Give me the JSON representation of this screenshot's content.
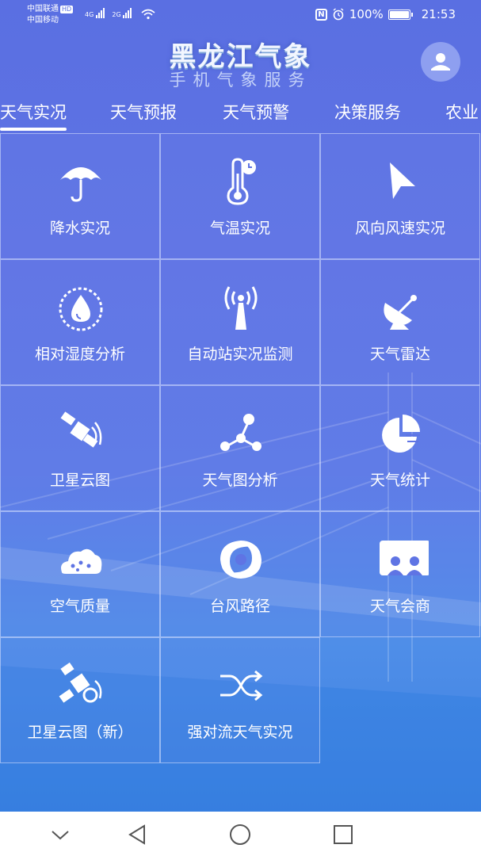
{
  "status_bar": {
    "carrier1": "中国联通",
    "hd_badge": "HD",
    "carrier2": "中国移动",
    "net1": "4G",
    "net2": "2G",
    "battery_percent": "100%",
    "battery_level": 1.0,
    "time": "21:53"
  },
  "header": {
    "title": "黑龙江气象",
    "subtitle": "手机气象服务"
  },
  "tabs": [
    "天气实况",
    "天气预报",
    "天气预警",
    "决策服务",
    "农业"
  ],
  "active_tab": "天气实况",
  "grid": {
    "items": [
      {
        "label": "降水实况",
        "icon": "umbrella-icon"
      },
      {
        "label": "气温实况",
        "icon": "thermometer-icon"
      },
      {
        "label": "风向风速实况",
        "icon": "wind-direction-icon"
      },
      {
        "label": "相对湿度分析",
        "icon": "humidity-gauge-icon"
      },
      {
        "label": "自动站实况监测",
        "icon": "weather-station-icon"
      },
      {
        "label": "天气雷达",
        "icon": "radar-dish-icon"
      },
      {
        "label": "卫星云图",
        "icon": "satellite-icon"
      },
      {
        "label": "天气图分析",
        "icon": "network-nodes-icon"
      },
      {
        "label": "天气统计",
        "icon": "pie-chart-icon"
      },
      {
        "label": "空气质量",
        "icon": "cloud-dots-icon"
      },
      {
        "label": "台风路径",
        "icon": "typhoon-icon"
      },
      {
        "label": "天气会商",
        "icon": "conference-icon"
      },
      {
        "label": "卫星云图（新）",
        "icon": "satellite-new-icon"
      },
      {
        "label": "强对流天气实况",
        "icon": "shuffle-icon"
      }
    ]
  },
  "colors": {
    "background": "#5f74e4",
    "icon_white": "#ffffff",
    "cell_border": "#dce6ff"
  }
}
